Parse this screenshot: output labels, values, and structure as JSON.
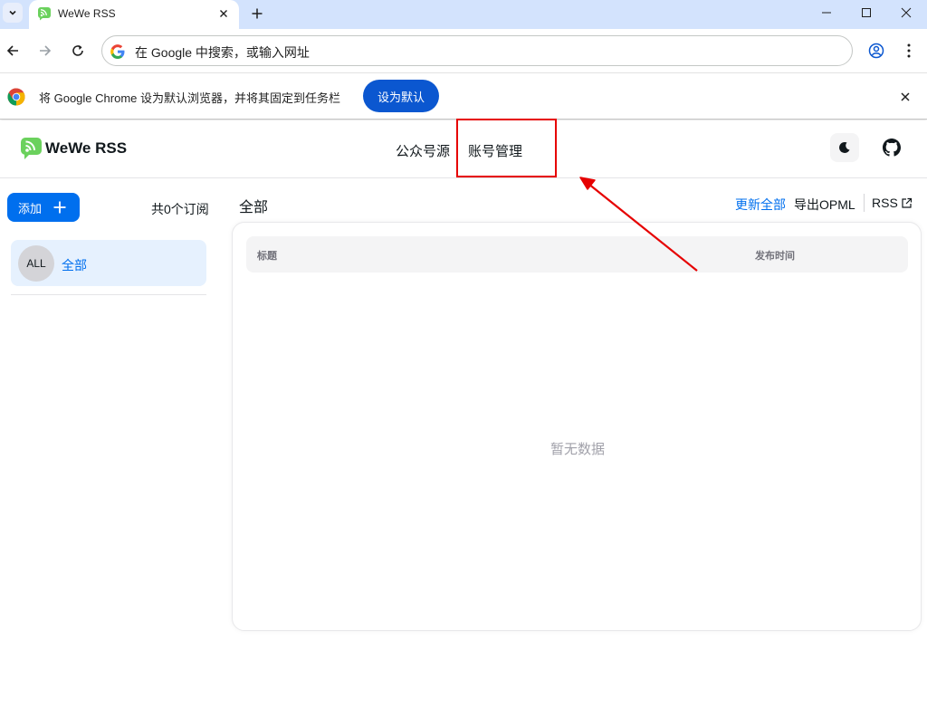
{
  "browser": {
    "tab_title": "WeWe RSS",
    "omnibox_placeholder": "在 Google 中搜索，或输入网址",
    "infobar_text": "将 Google Chrome 设为默认浏览器，并将其固定到任务栏",
    "infobar_button": "设为默认"
  },
  "app": {
    "brand": "WeWe RSS",
    "nav": [
      "公众号源",
      "账号管理"
    ],
    "accent": "#006fee"
  },
  "sidebar": {
    "add_label": "添加",
    "subscription_count": "共0个订阅",
    "feeds": [
      {
        "avatar": "ALL",
        "label": "全部"
      }
    ]
  },
  "main": {
    "title": "全部",
    "actions": {
      "update_all": "更新全部",
      "export_opml": "导出OPML",
      "rss": "RSS"
    },
    "table": {
      "columns": [
        "标题",
        "发布时间"
      ],
      "empty_text": "暂无数据"
    }
  },
  "annotation": {
    "color": "#e60000",
    "highlighted": "账号管理"
  }
}
